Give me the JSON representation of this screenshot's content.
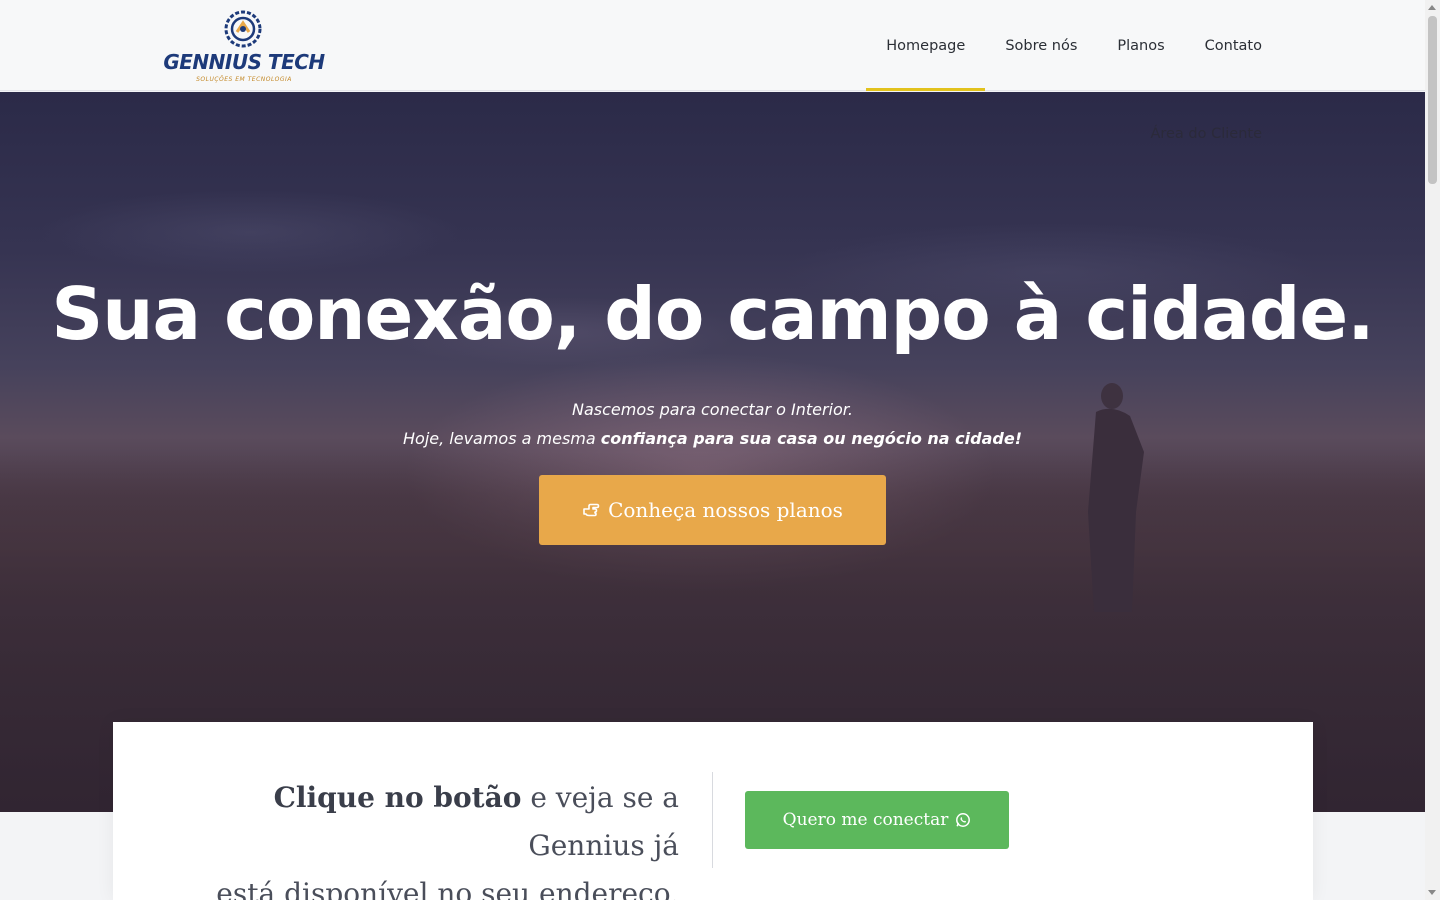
{
  "header": {
    "logo": {
      "name": "GENNIUS TECH",
      "tagline": "SOLUÇÕES EM TECNOLOGIA"
    },
    "nav": [
      {
        "label": "Homepage",
        "active": true
      },
      {
        "label": "Sobre nós",
        "active": false
      },
      {
        "label": "Planos",
        "active": false
      },
      {
        "label": "Contato",
        "active": false
      }
    ]
  },
  "hero": {
    "client_area": "Área do Cliente",
    "title": "Sua conexão, do campo à cidade.",
    "line1": "Nascemos para conectar o Interior.",
    "line2_prefix": "Hoje, levamos a mesma ",
    "line2_bold": "confiança para sua casa ou negócio na cidade!",
    "cta_label": "Conheça nossos planos",
    "cta_icon": "hand-pointer-icon"
  },
  "availability": {
    "text_bold": "Clique no botão",
    "text_rest_1": " e veja se a Gennius já",
    "text_rest_2": "está disponível no seu endereço.",
    "button_label": "Quero me conectar",
    "button_icon": "whatsapp-icon"
  },
  "colors": {
    "accent_yellow": "#e2c21d",
    "cta_orange": "#e8a84a",
    "whatsapp_green": "#5cb85c",
    "logo_blue": "#1d3a7a"
  }
}
